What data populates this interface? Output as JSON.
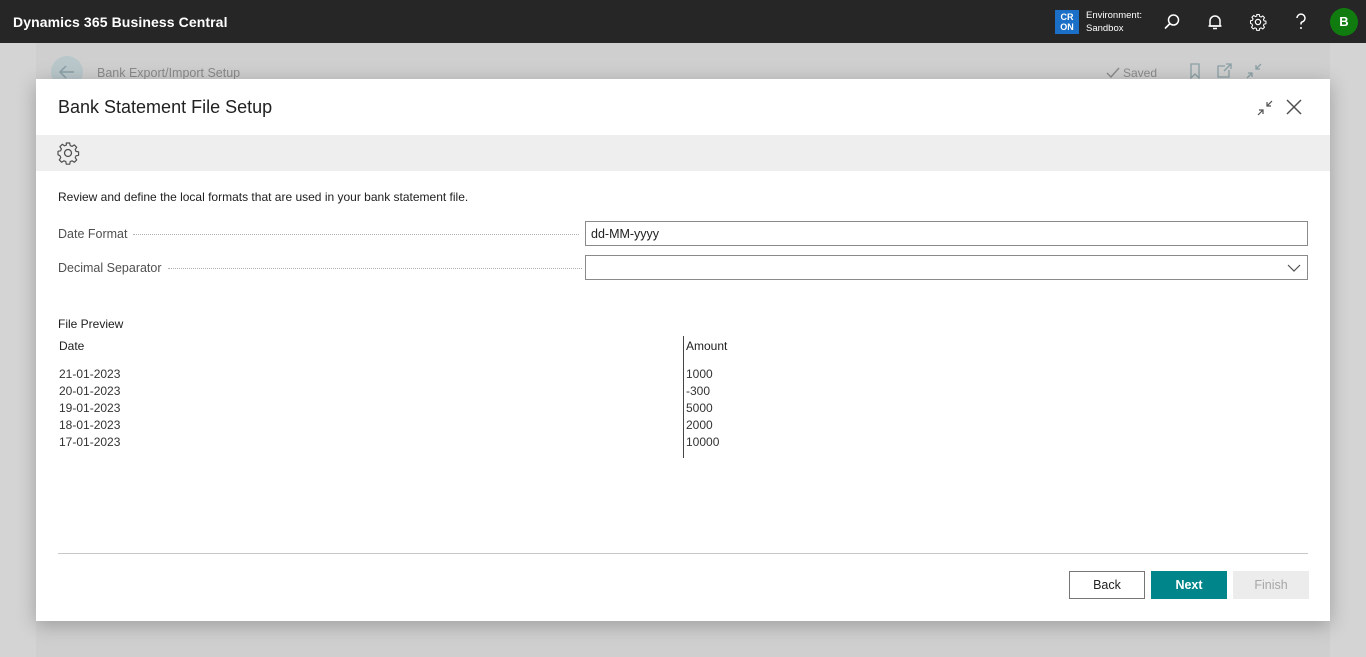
{
  "app": {
    "title": "Dynamics 365 Business Central",
    "environment_badge_line1": "CR",
    "environment_badge_line2": "ON",
    "environment_label": "Environment:",
    "environment_name": "Sandbox",
    "user_initial": "B",
    "icons": [
      "search-icon",
      "bell-icon",
      "gear-icon",
      "help-icon"
    ]
  },
  "background_page": {
    "title": "Bank Export/Import Setup",
    "status": "Saved"
  },
  "dialog": {
    "title": "Bank Statement File Setup",
    "instructions": "Review and define the local formats that are used in your bank statement file.",
    "fields": {
      "date_format": {
        "label": "Date Format",
        "value": "dd-MM-yyyy"
      },
      "decimal_separator": {
        "label": "Decimal Separator",
        "value": ""
      }
    },
    "file_preview": {
      "label": "File Preview",
      "columns": [
        "Date",
        "Amount"
      ],
      "rows": [
        [
          "21-01-2023",
          "1000"
        ],
        [
          "20-01-2023",
          "-300"
        ],
        [
          "19-01-2023",
          "5000"
        ],
        [
          "18-01-2023",
          "2000"
        ],
        [
          "17-01-2023",
          "10000"
        ]
      ]
    },
    "buttons": {
      "back": "Back",
      "next": "Next",
      "finish": "Finish"
    }
  },
  "colors": {
    "topbar": "#262626",
    "accent": "#00858a",
    "env_badge": "#1b6fc6",
    "avatar": "#107c10"
  }
}
